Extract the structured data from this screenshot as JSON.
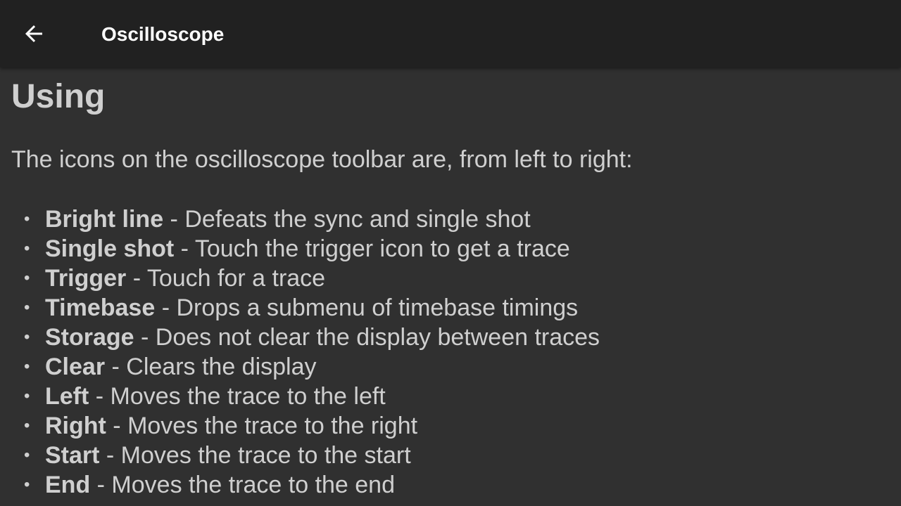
{
  "app_bar": {
    "title": "Oscilloscope",
    "back_icon": "arrow-back-icon"
  },
  "content": {
    "heading": "Using",
    "intro": "The icons on the oscilloscope toolbar are, from left to right:",
    "items": [
      {
        "term": "Bright line",
        "description": " - Defeats the sync and single shot"
      },
      {
        "term": "Single shot",
        "description": " - Touch the trigger icon to get a trace"
      },
      {
        "term": "Trigger",
        "description": " - Touch for a trace"
      },
      {
        "term": "Timebase",
        "description": " - Drops a submenu of timebase timings"
      },
      {
        "term": "Storage",
        "description": " - Does not clear the display between traces"
      },
      {
        "term": "Clear",
        "description": " - Clears the display"
      },
      {
        "term": "Left",
        "description": " - Moves the trace to the left"
      },
      {
        "term": "Right",
        "description": " - Moves the trace to the right"
      },
      {
        "term": "Start",
        "description": " - Moves the trace to the start"
      },
      {
        "term": "End",
        "description": " - Moves the trace to the end"
      }
    ],
    "bullet": "•"
  },
  "colors": {
    "app_bar_bg": "#212121",
    "content_bg": "#303030",
    "text": "#cfcfcf",
    "title_text": "#ffffff"
  }
}
